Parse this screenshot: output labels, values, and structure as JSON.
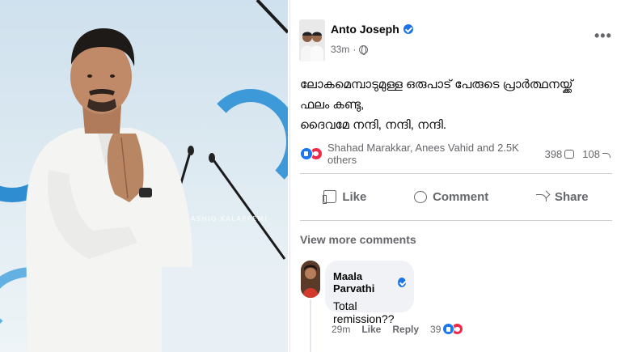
{
  "photo": {
    "watermark": "ASHIQ KALAPPEMI"
  },
  "post": {
    "author": "Anto Joseph",
    "time": "33m",
    "more_menu": "•••",
    "body_lines": [
      "ലോകമെമ്പാടുമുള്ള ഒരുപാട് പേരുടെ പ്രാർത്ഥനയ്ക്ക്",
      "ഫലം കണ്ടു,",
      "ദൈവമേ നന്ദി, നന്ദി, നന്ദി."
    ],
    "reactions_text": "Shahad Marakkar, Anees Vahid and 2.5K others",
    "comment_count": "398",
    "share_count": "108",
    "like_label": "Like",
    "comment_label": "Comment",
    "share_label": "Share",
    "view_more": "View more comments",
    "icons": [
      "globe-icon",
      "like-reaction-icon",
      "love-reaction-icon",
      "comment-icon",
      "share-icon",
      "verified-icon"
    ],
    "colors": {
      "facebook_blue": "#1877f2",
      "love_red": "#f0284a",
      "secondary_text": "#65676b"
    }
  },
  "comment": {
    "author": "Maala Parvathi",
    "text": "Total remission??",
    "time": "29m",
    "like_label": "Like",
    "reply_label": "Reply",
    "reaction_count": "39"
  }
}
